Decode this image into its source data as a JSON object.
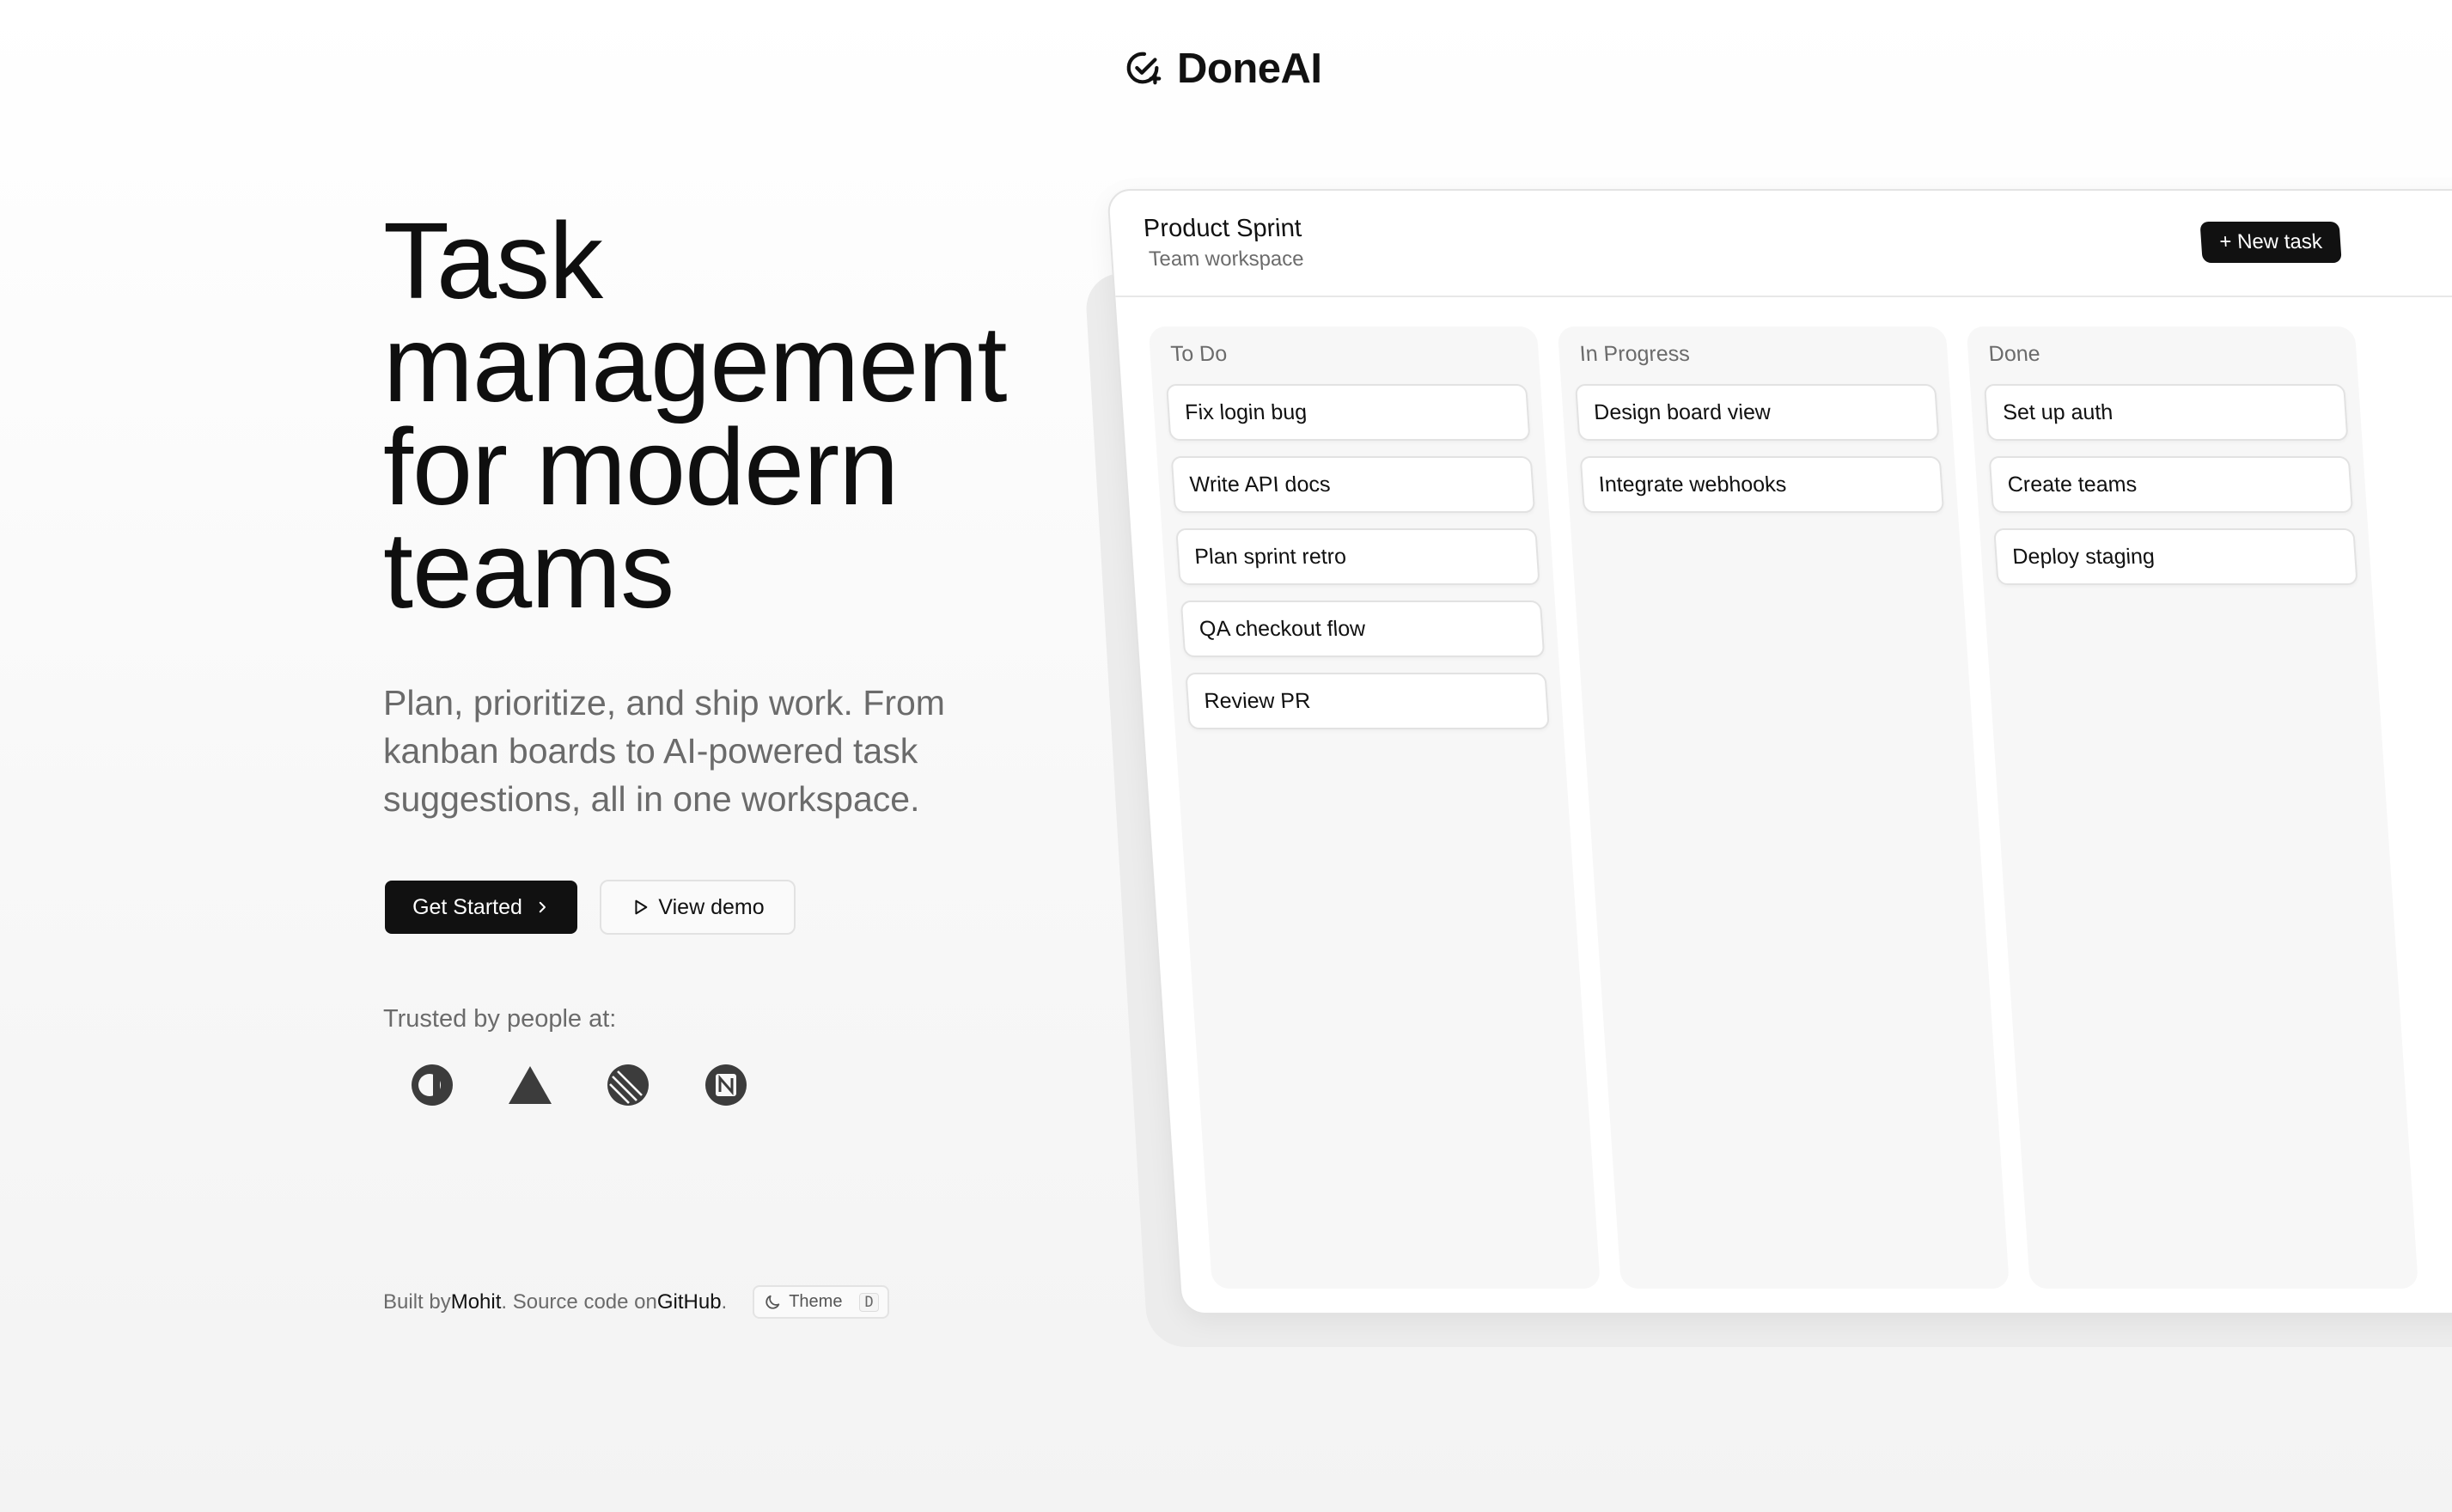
{
  "brand": {
    "name": "DoneAI",
    "icon": "check-sparkle-icon"
  },
  "hero": {
    "title_lines": [
      "Task",
      "management",
      "for modern",
      "teams"
    ],
    "subtitle_lines": [
      "Plan, prioritize, and ship work. From",
      "kanban boards to AI-powered task",
      "suggestions, all in one workspace."
    ],
    "primary_cta": "Get Started",
    "secondary_cta": "View demo"
  },
  "trusted": {
    "label": "Trusted by people at:",
    "logos": [
      "cal-logo-icon",
      "vercel-triangle-icon",
      "linear-logo-icon",
      "notion-logo-icon"
    ]
  },
  "footer": {
    "built_by_prefix": "Built by ",
    "author": "Mohit",
    "source_prefix": ". Source code on ",
    "source_link": "GitHub",
    "suffix": ".",
    "theme_label": "Theme",
    "theme_shortcut": "D"
  },
  "board": {
    "title": "Product Sprint",
    "subtitle": "Team workspace",
    "new_task_label": "+ New task",
    "columns": [
      {
        "title": "To Do",
        "cards": [
          "Fix login bug",
          "Write API docs",
          "Plan sprint retro",
          "QA checkout flow",
          "Review PR"
        ]
      },
      {
        "title": "In Progress",
        "cards": [
          "Design board view",
          "Integrate webhooks"
        ]
      },
      {
        "title": "Done",
        "cards": [
          "Set up auth",
          "Create teams",
          "Deploy staging"
        ]
      }
    ]
  },
  "colors": {
    "primary": "#111111",
    "muted_text": "#6b6b6b",
    "border": "#e2e2e2",
    "column_bg": "#f7f7f7"
  }
}
